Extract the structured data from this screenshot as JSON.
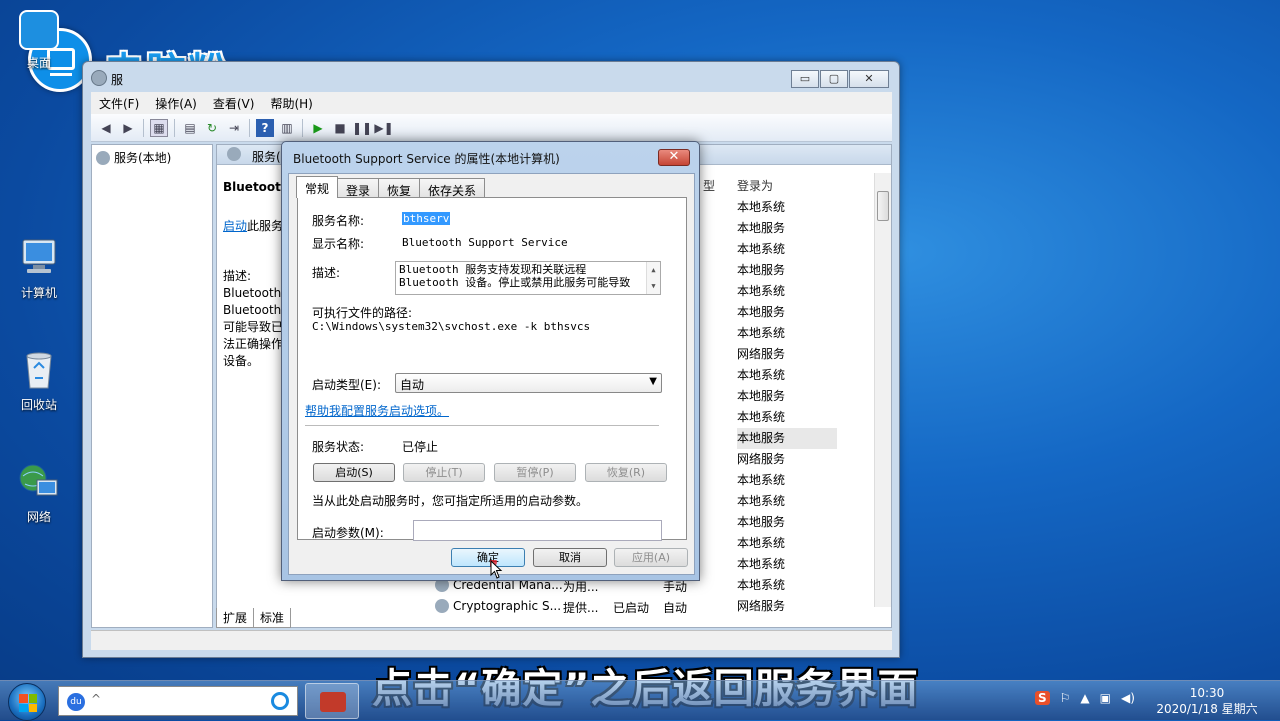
{
  "desktop": {
    "icons": [
      {
        "label": "桌面",
        "icon": "desktop-icon"
      },
      {
        "label": "计算机",
        "icon": "computer-icon"
      },
      {
        "label": "回收站",
        "icon": "recycle-bin-icon"
      },
      {
        "label": "网络",
        "icon": "network-icon"
      }
    ]
  },
  "watermark": {
    "brand": "电脑粉"
  },
  "main_window": {
    "title": "服",
    "controls": {
      "minimize": "▭",
      "maximize": "▢",
      "close": "✕"
    },
    "menu": [
      "文件(F)",
      "操作(A)",
      "查看(V)",
      "帮助(H)"
    ],
    "tree_root": "服务(本地)",
    "pane_header": "服务(",
    "detail": {
      "heading": "Bluetooth",
      "start_link": "启动",
      "start_suffix": "此服务",
      "desc_label": "描述:",
      "desc_lines": [
        "Bluetooth",
        "Bluetooth",
        "可能导致已",
        "法正确操作",
        "设备。"
      ]
    },
    "columns": {
      "type": "型",
      "logon": "登录为"
    },
    "logon_values": [
      "本地系统",
      "本地服务",
      "本地系统",
      "本地服务",
      "本地系统",
      "本地服务",
      "本地系统",
      "网络服务",
      "本地系统",
      "本地服务",
      "本地系统",
      "本地服务",
      "网络服务",
      "本地系统",
      "本地系统",
      "本地服务",
      "本地系统",
      "本地系统",
      "本地系统",
      "网络服务"
    ],
    "bottom_rows": [
      {
        "name": "Credential Mana...",
        "desc": "为用...",
        "status": "",
        "type": "手动"
      },
      {
        "name": "Cryptographic S...",
        "desc": "提供...",
        "status": "已启动",
        "type": "自动"
      }
    ],
    "bottom_tabs": [
      "扩展",
      "标准"
    ]
  },
  "dialog": {
    "title": "Bluetooth Support Service 的属性(本地计算机)",
    "close": "✕",
    "tabs": [
      "常规",
      "登录",
      "恢复",
      "依存关系"
    ],
    "service_name_label": "服务名称:",
    "service_name": "bthserv",
    "display_name_label": "显示名称:",
    "display_name": "Bluetooth Support Service",
    "description_label": "描述:",
    "description_lines": [
      "Bluetooth 服务支持发现和关联远程",
      "Bluetooth 设备。停止或禁用此服务可能导致"
    ],
    "path_label": "可执行文件的路径:",
    "path": "C:\\Windows\\system32\\svchost.exe -k bthsvcs",
    "startup_type_label": "启动类型(E):",
    "startup_type": "自动",
    "help_link": "帮助我配置服务启动选项。",
    "status_label": "服务状态:",
    "status": "已停止",
    "buttons": {
      "start": "启动(S)",
      "stop": "停止(T)",
      "pause": "暂停(P)",
      "resume": "恢复(R)"
    },
    "hint": "当从此处启动服务时，您可指定所适用的启动参数。",
    "params_label": "启动参数(M):",
    "params_value": "",
    "ok": "确定",
    "cancel": "取消",
    "apply": "应用(A)"
  },
  "taskbar": {
    "search_placeholder": "",
    "time": "10:30",
    "date": "2020/1/18 星期六"
  },
  "caption": "点击“确定”之后返回服务界面",
  "colors": {
    "accent": "#3399ff",
    "link": "#0066cc",
    "brand": "#1a9cf0"
  }
}
